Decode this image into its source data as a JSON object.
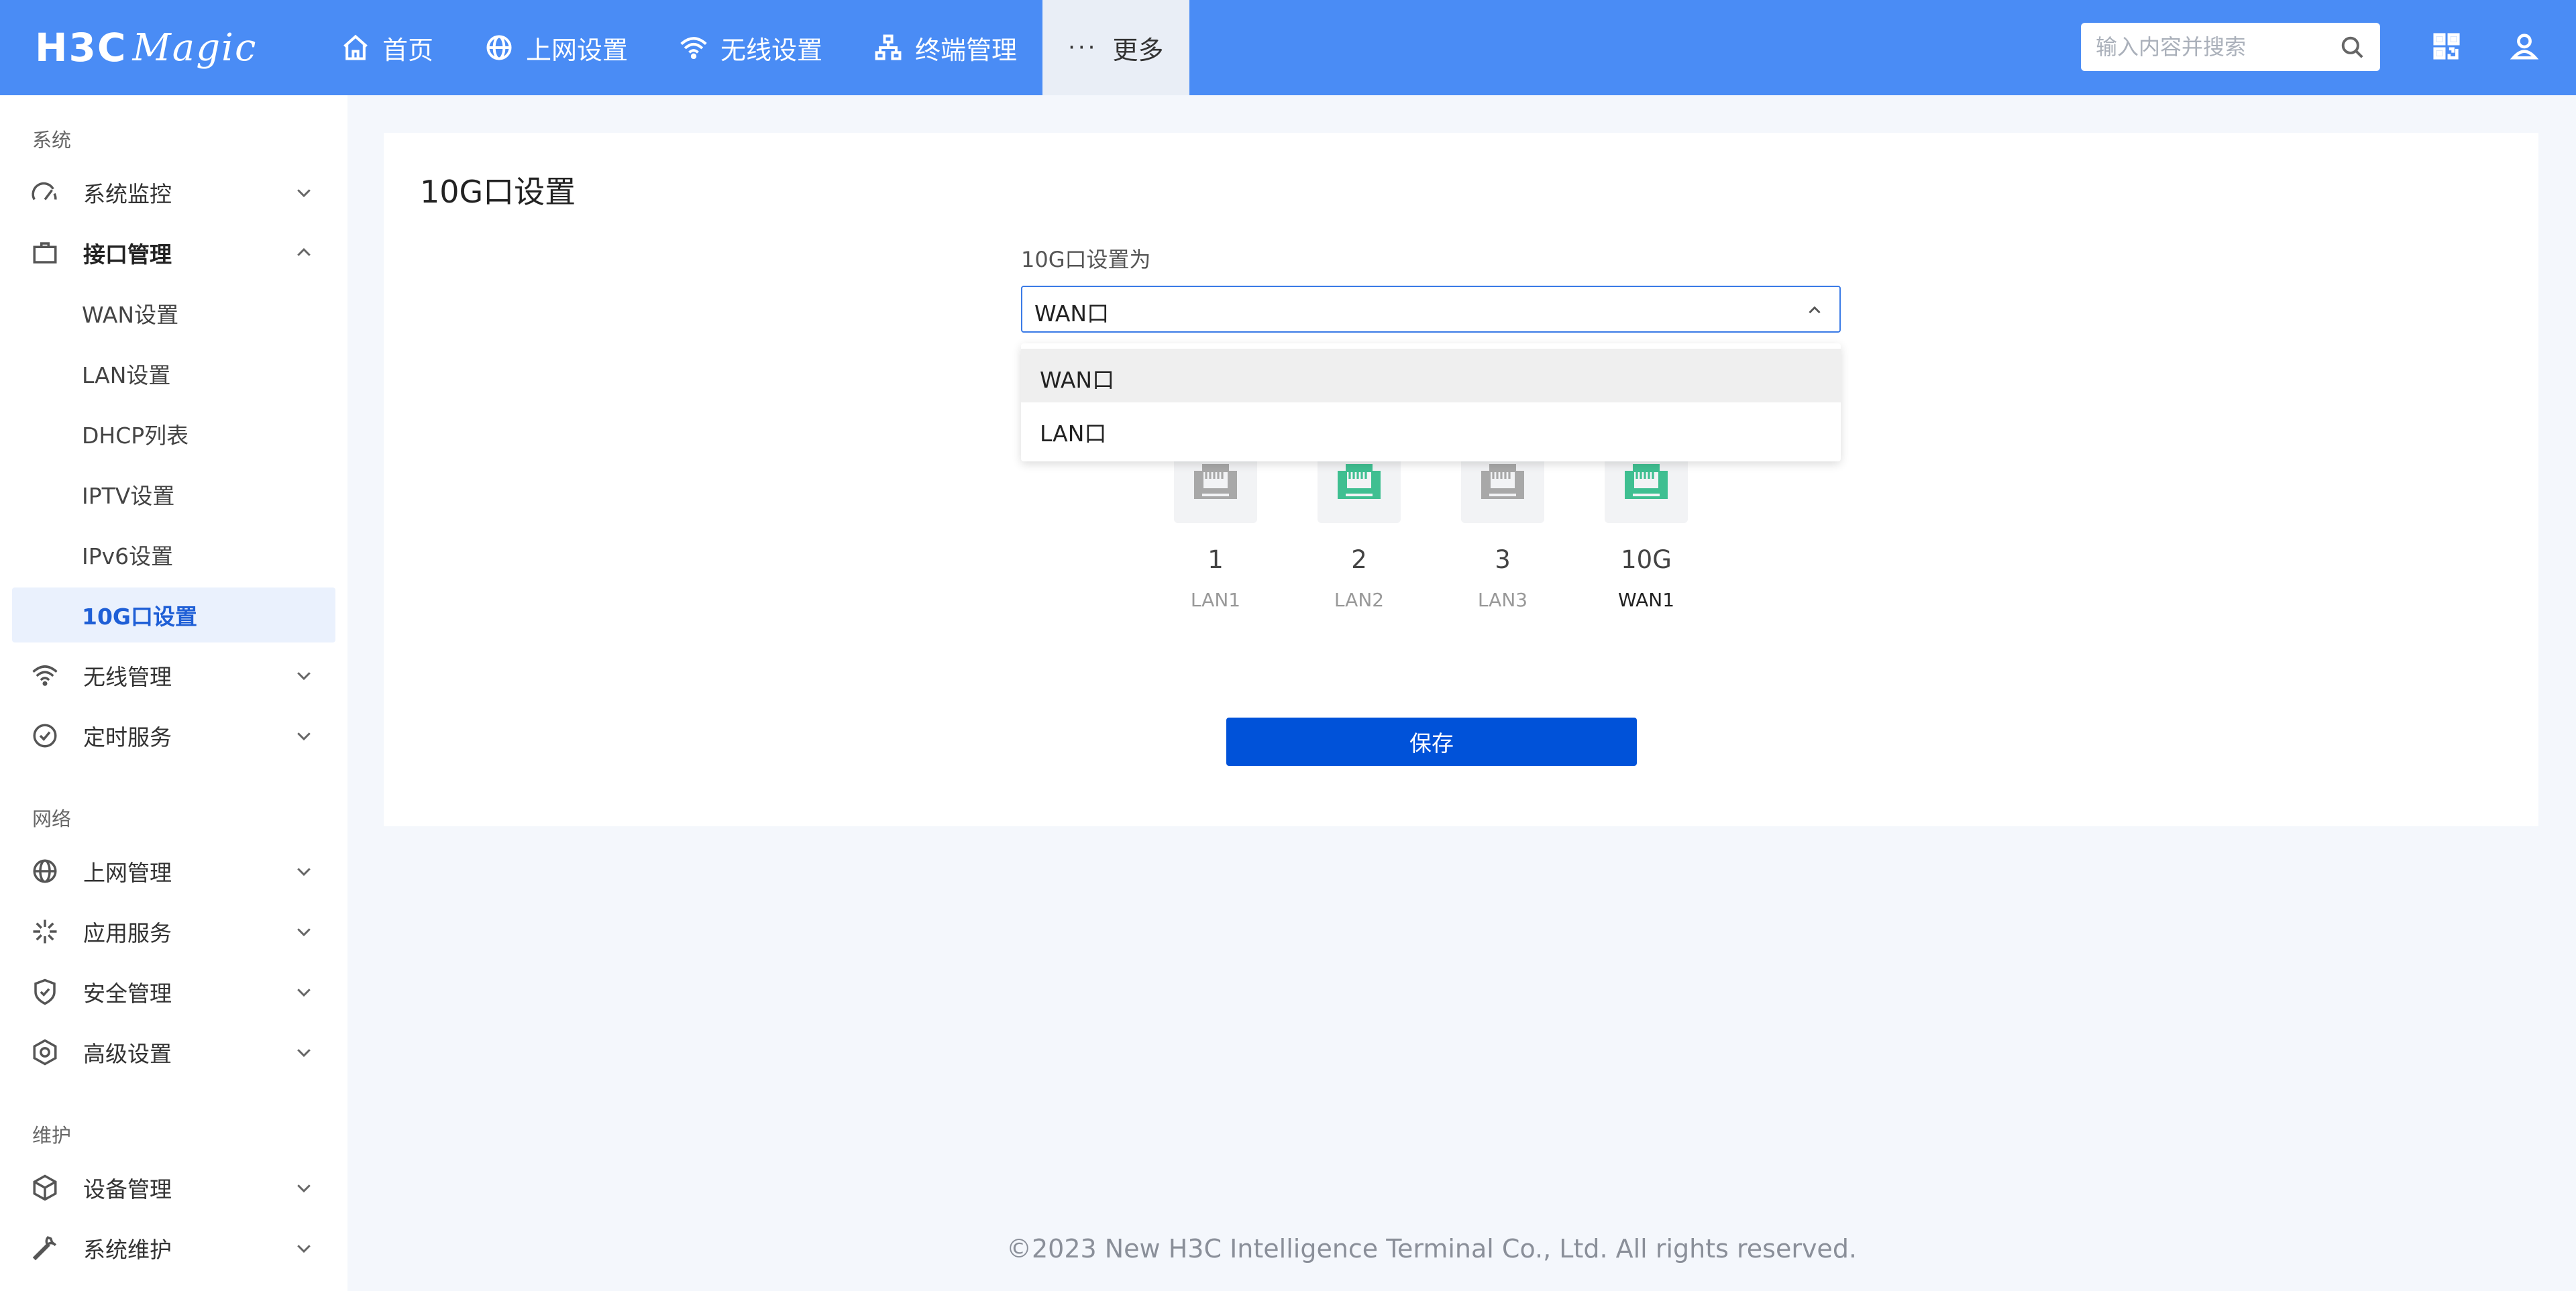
{
  "header": {
    "logo_main": "H3C",
    "logo_sub": "Magic",
    "nav": [
      {
        "label": "首页",
        "icon": "home-icon"
      },
      {
        "label": "上网设置",
        "icon": "globe-icon"
      },
      {
        "label": "无线设置",
        "icon": "wifi-icon"
      },
      {
        "label": "终端管理",
        "icon": "network-topology-icon"
      },
      {
        "label": "更多",
        "icon": "more-dots-icon"
      }
    ],
    "more_dots": "···",
    "search_placeholder": "输入内容并搜索"
  },
  "sidebar": {
    "groups": [
      {
        "title": "系统"
      },
      {
        "title": "网络"
      },
      {
        "title": "维护"
      }
    ],
    "items": [
      {
        "label": "系统监控"
      },
      {
        "label": "接口管理"
      },
      {
        "label": "WAN设置"
      },
      {
        "label": "LAN设置"
      },
      {
        "label": "DHCP列表"
      },
      {
        "label": "IPTV设置"
      },
      {
        "label": "IPv6设置"
      },
      {
        "label": "10G口设置"
      },
      {
        "label": "无线管理"
      },
      {
        "label": "定时服务"
      },
      {
        "label": "上网管理"
      },
      {
        "label": "应用服务"
      },
      {
        "label": "安全管理"
      },
      {
        "label": "高级设置"
      },
      {
        "label": "设备管理"
      },
      {
        "label": "系统维护"
      }
    ]
  },
  "main": {
    "title": "10G口设置",
    "field_label": "10G口设置为",
    "select_value": "WAN口",
    "options": [
      "WAN口",
      "LAN口"
    ],
    "ports": [
      {
        "number": "1",
        "name": "LAN1",
        "status": "inactive"
      },
      {
        "number": "2",
        "name": "LAN2",
        "status": "active"
      },
      {
        "number": "3",
        "name": "LAN3",
        "status": "inactive"
      },
      {
        "number": "10G",
        "name": "WAN1",
        "status": "active"
      }
    ],
    "save_label": "保存"
  },
  "colors": {
    "topbar": "#4a8cf5",
    "primary_button": "#0052d9",
    "port_active": "#3fbf91",
    "port_inactive": "#a8a8a8",
    "selected_menu_text": "#1f5fd6"
  },
  "footer": {
    "copyright": "©2023 New H3C Intelligence Terminal Co., Ltd. All rights reserved."
  }
}
